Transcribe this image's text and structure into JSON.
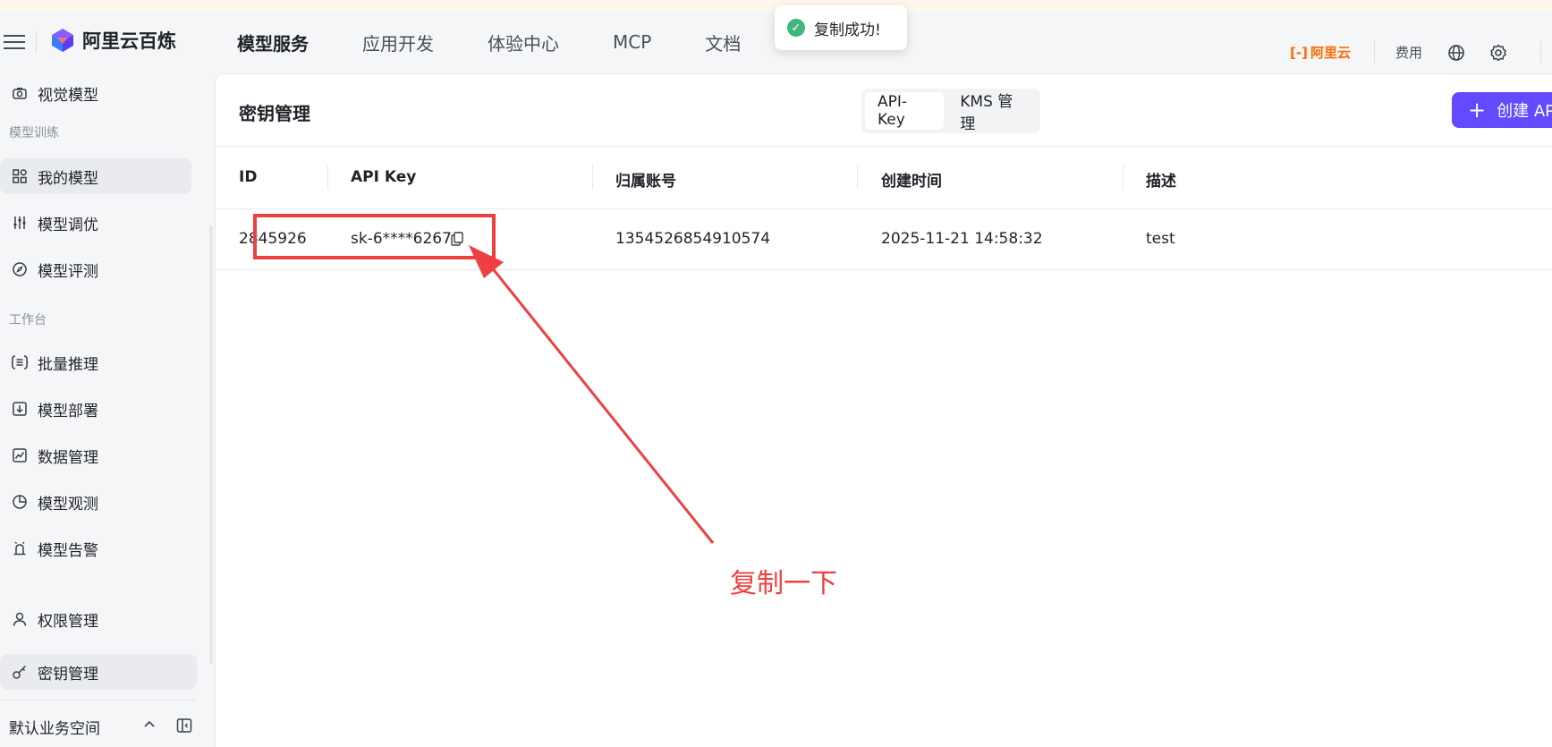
{
  "header": {
    "logo_text": "阿里云百炼",
    "nav": [
      "模型服务",
      "应用开发",
      "体验中心",
      "MCP",
      "文档"
    ],
    "toast": "复制成功!",
    "aliyun_logo": "阿里云",
    "fee": "费用",
    "icons": [
      "menu-icon",
      "globe-icon",
      "gear-icon"
    ]
  },
  "sidebar": {
    "item_visual": "视觉模型",
    "group_training": "模型训练",
    "item_my_models": "我的模型",
    "item_tuning": "模型调优",
    "item_eval": "模型评测",
    "group_workbench": "工作台",
    "item_batch": "批量推理",
    "item_deploy": "模型部署",
    "item_data": "数据管理",
    "item_observe": "模型观测",
    "item_alert": "模型告警",
    "item_permission": "权限管理",
    "item_keys": "密钥管理",
    "workspace": "默认业务空间"
  },
  "main": {
    "title": "密钥管理",
    "tabs": [
      "API-Key",
      "KMS 管理"
    ],
    "create_button": "创建 API",
    "columns": [
      "ID",
      "API Key",
      "归属账号",
      "创建时间",
      "描述"
    ],
    "rows": [
      {
        "id": "2845926",
        "api_key": "sk-6****6267",
        "account": "1354526854910574",
        "created": "2025-11-21 14:58:32",
        "desc": "test"
      }
    ]
  },
  "annotation": {
    "text": "复制一下",
    "color": "#ee4040"
  },
  "colors": {
    "accent": "#624aff",
    "toast_success": "#3fb67a",
    "aliyun_orange": "#ff6a00"
  }
}
